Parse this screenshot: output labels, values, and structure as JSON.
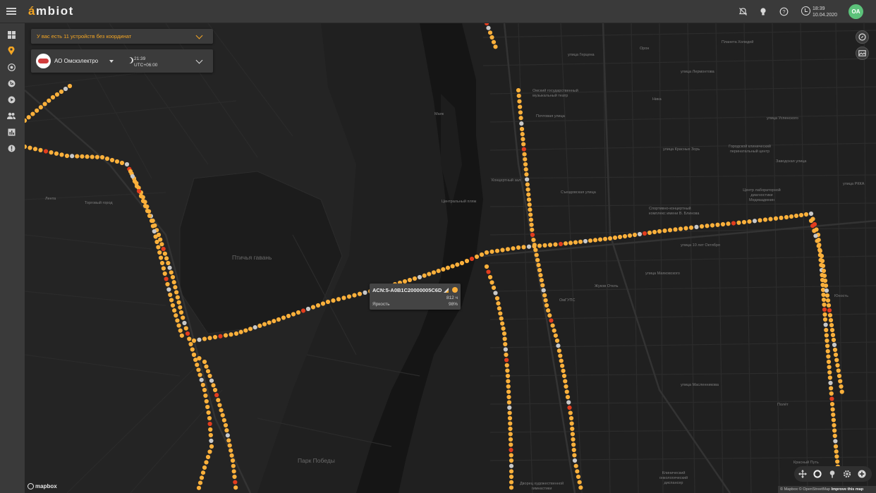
{
  "app": {
    "logo_accent": "á",
    "logo_rest": "mbiot"
  },
  "header": {
    "time": "18:39",
    "date": "10.04.2020",
    "user_initials": "OA",
    "icons": [
      "notifications-off-icon",
      "lightbulb-icon",
      "help-icon",
      "clock-icon"
    ]
  },
  "sidebar": {
    "items": [
      {
        "icon": "dashboard-icon",
        "active": false
      },
      {
        "icon": "map-pin-icon",
        "active": true
      },
      {
        "icon": "target-icon",
        "active": false
      },
      {
        "icon": "globe-icon",
        "active": false
      },
      {
        "icon": "play-icon",
        "active": false
      },
      {
        "icon": "users-icon",
        "active": false
      },
      {
        "icon": "report-icon",
        "active": false
      },
      {
        "icon": "info-icon",
        "active": false
      }
    ]
  },
  "alert": {
    "text": "У вас есть 11 устройств без координат"
  },
  "organization": {
    "name": "АО Омскэлектро",
    "time": "21:39",
    "timezone": "UTC+06:00"
  },
  "tooltip": {
    "device_id": "ACN:5-A0B1C20000005C6D",
    "hours": "812 ч",
    "label": "Яркость",
    "value": "98%"
  },
  "map_labels": {
    "poi": [
      "Омский государственный музыкальный театр",
      "Почтовая улица",
      "Концертный зал",
      "Центральный пляж",
      "Спортивно-концертный комплекс имени В. Блинова",
      "Жуков Отель",
      "ОмГУПС",
      "Городской клинический перинатальный центр",
      "Центр лабораторной диагностики Медиаадмнин",
      "Клинический онкологический диспансер",
      "Дворец художественной гимнастики",
      "Лента",
      "Торговый город",
      "Маяк",
      "Ника",
      "Орон",
      "Юность",
      "Полёт",
      "Планета Холидей",
      "улица Герцена",
      "улица Лермонтова",
      "улица Успенского",
      "улица Красных Зорь",
      "Съездовская улица",
      "улица Маяковского",
      "улица 10 лет Октября",
      "Заводская улица",
      "улица РККА",
      "улица Масленникова",
      "Красный Путь"
    ],
    "areas": [
      "Птичья гавань",
      "Парк Победы"
    ]
  },
  "map_controls": [
    "compass-icon",
    "layers-icon"
  ],
  "bottom_controls": [
    "move-icon",
    "circle-select-icon",
    "pin-select-icon",
    "gear-icon",
    "add-icon"
  ],
  "attribution": {
    "text": "© Mapbox © OpenStreetMap",
    "link": "Improve this map",
    "logo": "mapbox"
  },
  "colors": {
    "accent": "#f5a623",
    "device_ok": "#fbb03b",
    "device_alarm": "#e23d1e",
    "device_offline": "#c8c8c8",
    "avatar": "#5cc27a"
  }
}
